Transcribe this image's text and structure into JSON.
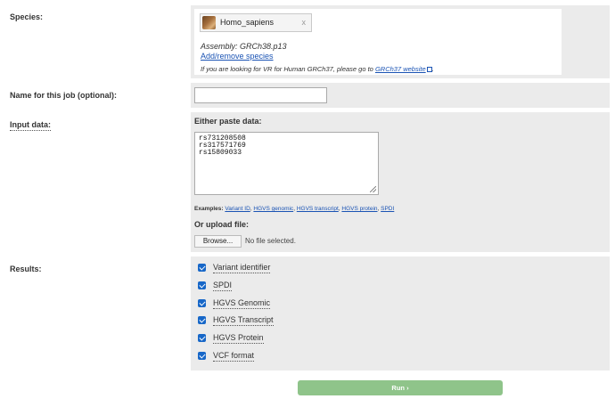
{
  "labels": {
    "species": "Species:",
    "job_name": "Name for this job (optional):",
    "input_data": "Input data:",
    "results": "Results:"
  },
  "species": {
    "name": "Homo_sapiens",
    "remove_glyph": "x",
    "assembly": "Assembly: GRCh38.p13",
    "add_remove_link": "Add/remove species",
    "hint_text": "If you are looking for VR for Human GRCh37, please go to ",
    "hint_link": "GRCh37 website",
    "hint_end": "."
  },
  "job_name": {
    "value": "",
    "placeholder": ""
  },
  "input": {
    "either_label": "Either paste data:",
    "pasted_data": "rs731208508\nrs317571769\nrs15809033",
    "examples_label": "Examples:",
    "examples": [
      "Variant ID",
      "HGVS genomic",
      "HGVS transcript",
      "HGVS protein",
      "SPDI"
    ],
    "upload_label": "Or upload file:",
    "browse_label": "Browse...",
    "no_file_text": "No file selected."
  },
  "results": [
    {
      "label": "Variant identifier",
      "checked": true
    },
    {
      "label": "SPDI",
      "checked": true
    },
    {
      "label": "HGVS Genomic",
      "checked": true
    },
    {
      "label": "HGVS Transcript",
      "checked": true
    },
    {
      "label": "HGVS Protein",
      "checked": true
    },
    {
      "label": "VCF format",
      "checked": true
    }
  ],
  "run_label": "Run ›",
  "colors": {
    "link": "#1a53b4",
    "checkbox": "#1767c8",
    "run_button": "#8fc48a",
    "panel_bg": "#ebebeb"
  }
}
